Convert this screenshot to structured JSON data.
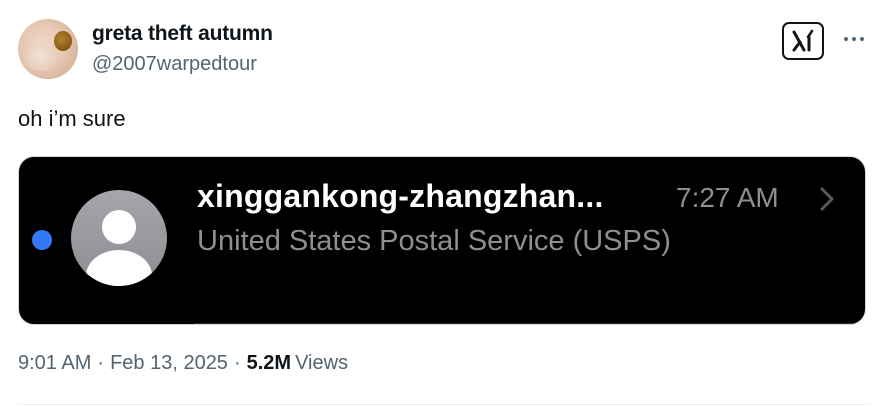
{
  "user": {
    "display_name": "greta theft autumn",
    "handle": "@2007warpedtour"
  },
  "tweet": {
    "text": "oh i’m sure"
  },
  "media": {
    "sender": "xinggankong-zhangzhan...",
    "time": "7:27 AM",
    "preview": "United States Postal Service (USPS)",
    "colors": {
      "background": "#000000",
      "unread_dot": "#3478f6",
      "secondary_text": "#8e8e93"
    }
  },
  "meta": {
    "time": "9:01 AM",
    "separator": "·",
    "date": "Feb 13, 2025",
    "views_count": "5.2M",
    "views_label": "Views"
  },
  "icons": {
    "grok": "grok-icon",
    "more": "more-icon",
    "chevron": "chevron-right-icon"
  }
}
